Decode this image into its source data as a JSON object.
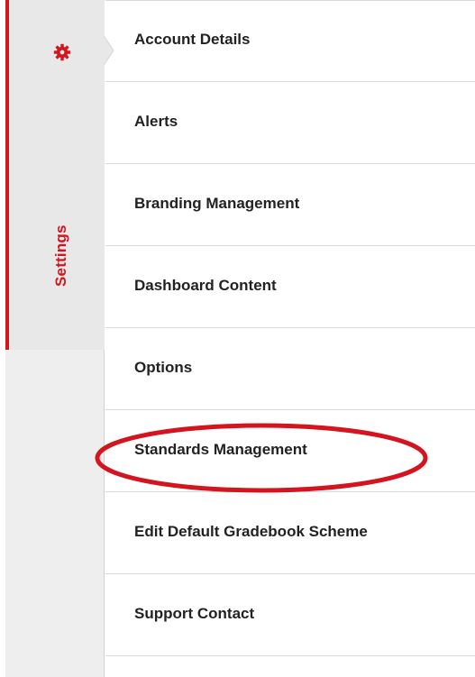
{
  "settings_tab": {
    "label": "Settings",
    "icon": "gear-icon",
    "accent_color": "#d4141e"
  },
  "menu": {
    "items": [
      {
        "label": "Account Details"
      },
      {
        "label": "Alerts"
      },
      {
        "label": "Branding Management"
      },
      {
        "label": "Dashboard Content"
      },
      {
        "label": "Options"
      },
      {
        "label": "Standards Management"
      },
      {
        "label": "Edit Default Gradebook Scheme"
      },
      {
        "label": "Support Contact"
      }
    ],
    "highlighted_item": "Standards Management",
    "highlight_color": "#d4141e"
  }
}
